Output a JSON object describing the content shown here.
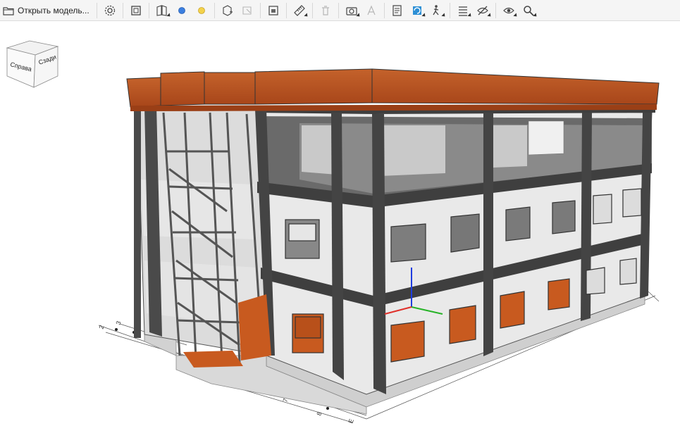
{
  "toolbar": {
    "open_model_label": "Открыть модель...",
    "tools": [
      {
        "name": "settings-gear-icon",
        "dropdown": false,
        "enabled": true
      },
      {
        "name": "fit-view-icon",
        "dropdown": false,
        "enabled": true
      },
      {
        "name": "section-planes-icon",
        "dropdown": true,
        "enabled": true
      },
      {
        "name": "blue-marker-icon",
        "dropdown": false,
        "enabled": true
      },
      {
        "name": "yellow-marker-icon",
        "dropdown": false,
        "enabled": true
      },
      {
        "name": "add-object-icon",
        "dropdown": false,
        "enabled": true
      },
      {
        "name": "select-object-icon",
        "dropdown": false,
        "enabled": false
      },
      {
        "name": "calendar-view-icon",
        "dropdown": false,
        "enabled": true
      },
      {
        "name": "measure-ruler-icon",
        "dropdown": true,
        "enabled": true
      },
      {
        "name": "delete-icon",
        "dropdown": false,
        "enabled": false
      },
      {
        "name": "camera-icon",
        "dropdown": true,
        "enabled": true
      },
      {
        "name": "annotation-icon",
        "dropdown": false,
        "enabled": false
      },
      {
        "name": "properties-icon",
        "dropdown": false,
        "enabled": true
      },
      {
        "name": "rotate-view-icon",
        "dropdown": true,
        "enabled": true
      },
      {
        "name": "walk-mode-icon",
        "dropdown": true,
        "enabled": true
      },
      {
        "name": "layers-list-icon",
        "dropdown": true,
        "enabled": true
      },
      {
        "name": "hide-eye-icon",
        "dropdown": true,
        "enabled": true
      },
      {
        "name": "show-eye-icon",
        "dropdown": true,
        "enabled": true
      },
      {
        "name": "zoom-search-icon",
        "dropdown": true,
        "enabled": true
      }
    ]
  },
  "navcube": {
    "face_left": "Справа",
    "face_right": "Сзади"
  },
  "grid_labels": {
    "right_axis": [
      "6",
      "7",
      "8"
    ],
    "left_axis": [
      "2",
      "3"
    ],
    "letter_axis": [
      "Е"
    ]
  },
  "colors": {
    "roof": "#b5501e",
    "floor_orange": "#c85a1f",
    "wall": "#e9e9e9",
    "frame": "#4a4a4a",
    "axis_x": "#e0302a",
    "axis_y": "#27b327",
    "axis_z": "#1f3de0"
  }
}
